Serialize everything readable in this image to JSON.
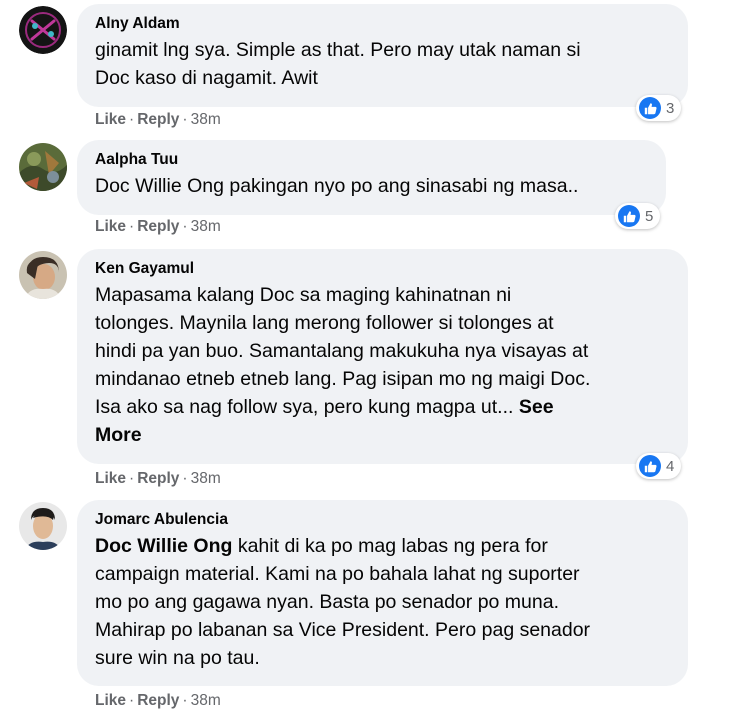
{
  "comments": [
    {
      "author": "Alny Aldam",
      "lines": [
        "ginamit lng sya. Simple as that. Pero may utak naman si",
        "Doc kaso di nagamit. Awit"
      ],
      "reactions": "3",
      "like": "Like",
      "reply": "Reply",
      "time": "38m"
    },
    {
      "author": "Aalpha Tuu",
      "lines": [
        "Doc Willie Ong pakingan nyo po ang sinasabi ng masa.."
      ],
      "reactions": "5",
      "like": "Like",
      "reply": "Reply",
      "time": "38m"
    },
    {
      "author": "Ken Gayamul",
      "lines": [
        "Mapasama kalang Doc sa maging kahinatnan ni",
        "tolonges. Maynila lang merong follower si tolonges at",
        "hindi pa yan buo. Samantalang makukuha nya visayas at",
        "mindanao etneb etneb lang. Pag isipan mo ng maigi Doc.",
        "Isa ako sa nag follow sya, pero kung magpa ut..."
      ],
      "see_more_1": "See",
      "see_more_2": "More",
      "reactions": "4",
      "like": "Like",
      "reply": "Reply",
      "time": "38m"
    },
    {
      "author": "Jomarc Abulencia",
      "mention": "Doc Willie Ong",
      "lines": [
        " kahit di ka po mag labas ng pera for",
        "campaign material. Kami na po bahala lahat ng suporter",
        "mo po ang gagawa nyan. Basta po senador po muna.",
        "Mahirap po labanan sa Vice President. Pero pag senador",
        "sure win na po tau."
      ],
      "like": "Like",
      "reply": "Reply",
      "time": "38m"
    }
  ],
  "separator": "·",
  "icons": {
    "like_badge": "thumbs-up-icon",
    "avatar": "avatar"
  },
  "colors": {
    "bubble": "#f0f2f5",
    "like_blue": "#1877f2",
    "meta_gray": "#65676b"
  }
}
